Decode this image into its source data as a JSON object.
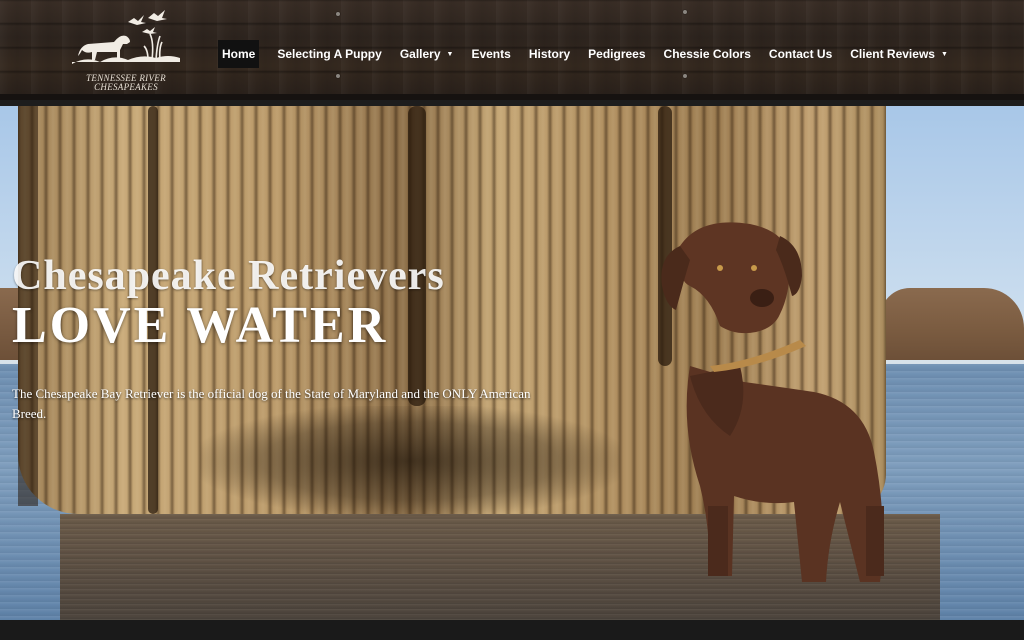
{
  "logo": {
    "line1": "TENNESSEE RIVER",
    "line2": "CHESAPEAKES"
  },
  "nav": {
    "items": [
      {
        "label": "Home",
        "active": true
      },
      {
        "label": "Selecting A Puppy"
      },
      {
        "label": "Gallery",
        "dropdown": true
      },
      {
        "label": "Events"
      },
      {
        "label": "History"
      },
      {
        "label": "Pedigrees"
      },
      {
        "label": "Chessie Colors"
      },
      {
        "label": "Contact Us"
      },
      {
        "label": "Client Reviews",
        "dropdown": true
      }
    ],
    "caret_icon": "chevron-down-icon"
  },
  "hero": {
    "title": "Chesapeake Retrievers",
    "title_big": "LOVE WATER",
    "subtitle": "The Chesapeake Bay Retriever is the official dog of the State of Maryland and the ONLY American Breed."
  },
  "colors": {
    "header_wood": "#2d241e",
    "nav_active_bg": "#111111",
    "nav_text": "#ffffff",
    "dog_brown": "#5a3322"
  }
}
